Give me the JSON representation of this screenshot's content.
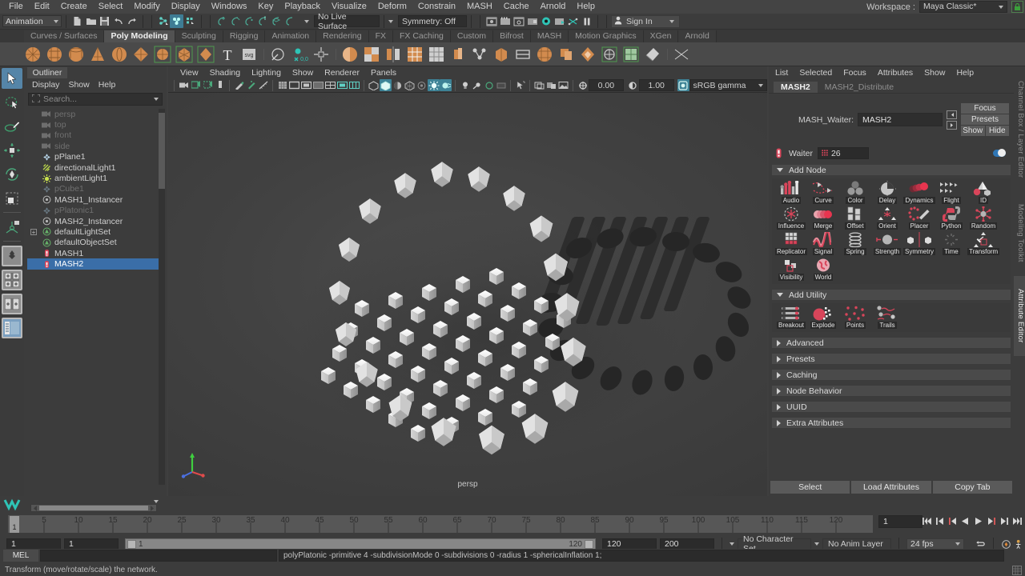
{
  "menubar": {
    "items": [
      "File",
      "Edit",
      "Create",
      "Select",
      "Modify",
      "Display",
      "Windows",
      "Key",
      "Playback",
      "Visualize",
      "Deform",
      "Constrain",
      "MASH",
      "Cache",
      "Arnold",
      "Help"
    ],
    "workspace_label": "Workspace :",
    "workspace_value": "Maya Classic*",
    "lock_icon": "lock-icon"
  },
  "statusline": {
    "mode": "Animation",
    "live_surface": "No Live Surface",
    "symmetry": "Symmetry: Off",
    "signin": "Sign In",
    "icons": [
      "new-scene-icon",
      "open-scene-icon",
      "save-scene-icon",
      "undo-icon",
      "redo-icon",
      "select-hierarchy-icon",
      "select-object-icon",
      "select-component-icon",
      "snap-grid-icon",
      "snap-curve-icon",
      "snap-point-icon",
      "snap-projected-icon",
      "snap-view-plane-icon",
      "make-live-icon",
      "render-current-frame-icon",
      "ipr-render-icon",
      "render-settings-icon",
      "hypershade-icon",
      "render-view-icon",
      "render-sequence-icon",
      "editor-icon",
      "pause-icon",
      "user-icon"
    ]
  },
  "shelf": {
    "tabs": [
      "Curves / Surfaces",
      "Poly Modeling",
      "Sculpting",
      "Rigging",
      "Animation",
      "Rendering",
      "FX",
      "FX Caching",
      "Custom",
      "Bifrost",
      "MASH",
      "Motion Graphics",
      "XGen",
      "Arnold"
    ],
    "active_tab": "Poly Modeling",
    "icons": [
      "poly-sphere-icon",
      "poly-cube-icon",
      "poly-cylinder-icon",
      "poly-cone-icon",
      "poly-torus-icon",
      "poly-plane-icon",
      "poly-disc-icon",
      "poly-platonic-icon",
      "poly-prism-icon",
      "poly-type-icon",
      "poly-svg-icon",
      "poly-sculpt-icon",
      "poly-target-weld-icon",
      "poly-move-icon",
      "combine-icon",
      "boolean-icon",
      "mirror-icon",
      "multi-cut-icon",
      "quad-draw-icon",
      "extrude-icon",
      "bevel-icon",
      "bridge-icon",
      "append-icon",
      "wedge-icon",
      "duplicate-face-icon",
      "circularize-icon",
      "smooth-icon",
      "reduce-icon",
      "triangulate-icon",
      "quadrangulate-icon",
      "crease-icon",
      "uv-editor-icon",
      "normals-icon"
    ]
  },
  "toolbox": {
    "tools": [
      "select-tool",
      "lasso-select-tool",
      "paint-select-tool",
      "move-tool",
      "rotate-tool",
      "scale-tool",
      "last-tool",
      "soft-select-tool",
      "single-pane-layout",
      "four-pane-layout",
      "two-pane-layout",
      "outliner-persp-layout"
    ],
    "active": "select-tool"
  },
  "outliner": {
    "title": "Outliner",
    "menus": [
      "Display",
      "Show",
      "Help"
    ],
    "search_placeholder": "Search...",
    "items": [
      {
        "label": "persp",
        "icon": "camera-icon",
        "state": "dim"
      },
      {
        "label": "top",
        "icon": "camera-icon",
        "state": "dim"
      },
      {
        "label": "front",
        "icon": "camera-icon",
        "state": "dim"
      },
      {
        "label": "side",
        "icon": "camera-icon",
        "state": "dim"
      },
      {
        "label": "pPlane1",
        "icon": "transform-icon",
        "state": "normal"
      },
      {
        "label": "directionalLight1",
        "icon": "directional-light-icon",
        "state": "normal"
      },
      {
        "label": "ambientLight1",
        "icon": "ambient-light-icon",
        "state": "normal"
      },
      {
        "label": "pCube1",
        "icon": "transform-icon",
        "state": "dim"
      },
      {
        "label": "MASH1_Instancer",
        "icon": "instancer-icon",
        "state": "normal"
      },
      {
        "label": "pPlatonic1",
        "icon": "transform-icon",
        "state": "dim"
      },
      {
        "label": "MASH2_Instancer",
        "icon": "instancer-icon",
        "state": "normal"
      },
      {
        "label": "defaultLightSet",
        "icon": "set-icon",
        "state": "normal",
        "expandable": true
      },
      {
        "label": "defaultObjectSet",
        "icon": "set-icon",
        "state": "normal"
      },
      {
        "label": "MASH1",
        "icon": "mash-icon",
        "state": "normal"
      },
      {
        "label": "MASH2",
        "icon": "mash-icon",
        "state": "selected"
      }
    ]
  },
  "viewport": {
    "menus": [
      "View",
      "Shading",
      "Lighting",
      "Show",
      "Renderer",
      "Panels"
    ],
    "camera_label": "persp",
    "gamma_value_1": "0.00",
    "gamma_value_2": "1.00",
    "color_space": "sRGB gamma",
    "toolbar_icons": [
      "camera-attributes-icon",
      "two-pane-icon",
      "bookmark-icon",
      "image-plane-icon",
      "paint-effects-icon",
      "grease-pencil-icon",
      "measure-icon",
      "grid-icon",
      "film-gate-icon",
      "resolution-gate-icon",
      "gate-mask-icon",
      "xray-icon",
      "xray-joints-icon",
      "wireframe-icon",
      "smooth-shade-icon",
      "hardware-texture-icon",
      "use-all-lights-icon",
      "shadows-icon",
      "screen-space-ao-icon",
      "motion-blur-icon",
      "multisample-icon",
      "isolate-select-icon",
      "lights-icon",
      "no-lights-icon",
      "default-lights-icon",
      "all-lights-icon",
      "select-mask-icon",
      "display-layer-icon",
      "panel-layout-icon",
      "exposure-icon"
    ]
  },
  "attribute_editor": {
    "menus": [
      "List",
      "Selected",
      "Focus",
      "Attributes",
      "Show",
      "Help"
    ],
    "tabs": [
      {
        "label": "MASH2",
        "active": true
      },
      {
        "label": "MASH2_Distribute",
        "active": false
      }
    ],
    "node_label": "MASH_Waiter:",
    "node_value": "MASH2",
    "buttons": {
      "focus": "Focus",
      "presets": "Presets",
      "show": "Show",
      "hide": "Hide"
    },
    "waiter": {
      "label": "Waiter",
      "value": "26",
      "icon": "mash-waiter-icon"
    },
    "sections": {
      "add_node": "Add Node",
      "add_utility": "Add Utility",
      "collapsed": [
        "Advanced",
        "Presets",
        "Caching",
        "Node Behavior",
        "UUID",
        "Extra Attributes"
      ]
    },
    "nodes": [
      {
        "label": "Audio",
        "icon": "audio-node-icon"
      },
      {
        "label": "Curve",
        "icon": "curve-node-icon"
      },
      {
        "label": "Color",
        "icon": "color-node-icon"
      },
      {
        "label": "Delay",
        "icon": "delay-node-icon"
      },
      {
        "label": "Dynamics",
        "icon": "dynamics-node-icon"
      },
      {
        "label": "Flight",
        "icon": "flight-node-icon"
      },
      {
        "label": "ID",
        "icon": "id-node-icon"
      },
      {
        "label": "Influence",
        "icon": "influence-node-icon"
      },
      {
        "label": "Merge",
        "icon": "merge-node-icon"
      },
      {
        "label": "Offset",
        "icon": "offset-node-icon"
      },
      {
        "label": "Orient",
        "icon": "orient-node-icon"
      },
      {
        "label": "Placer",
        "icon": "placer-node-icon"
      },
      {
        "label": "Python",
        "icon": "python-node-icon"
      },
      {
        "label": "Random",
        "icon": "random-node-icon"
      },
      {
        "label": "Replicator",
        "icon": "replicator-node-icon"
      },
      {
        "label": "Signal",
        "icon": "signal-node-icon"
      },
      {
        "label": "Spring",
        "icon": "spring-node-icon"
      },
      {
        "label": "Strength",
        "icon": "strength-node-icon"
      },
      {
        "label": "Symmetry",
        "icon": "symmetry-node-icon"
      },
      {
        "label": "Time",
        "icon": "time-node-icon"
      },
      {
        "label": "Transform",
        "icon": "transform-node-icon"
      },
      {
        "label": "Visibility",
        "icon": "visibility-node-icon"
      },
      {
        "label": "World",
        "icon": "world-node-icon"
      }
    ],
    "utilities": [
      {
        "label": "Breakout",
        "icon": "breakout-utility-icon"
      },
      {
        "label": "Explode",
        "icon": "explode-utility-icon"
      },
      {
        "label": "Points",
        "icon": "points-utility-icon"
      },
      {
        "label": "Trails",
        "icon": "trails-utility-icon"
      }
    ],
    "bottom_buttons": [
      "Select",
      "Load Attributes",
      "Copy Tab"
    ],
    "vertical_tabs": [
      {
        "label": "Channel Box / Layer Editor",
        "active": false
      },
      {
        "label": "Modeling Toolkit",
        "active": false
      },
      {
        "label": "Attribute Editor",
        "active": true
      }
    ]
  },
  "timeline": {
    "ticks": [
      5,
      10,
      15,
      20,
      25,
      30,
      35,
      40,
      45,
      50,
      55,
      60,
      65,
      70,
      75,
      80,
      85,
      90,
      95,
      100,
      105,
      110,
      115,
      120
    ],
    "current_frame_marker": "1",
    "current_frame_field": "1",
    "playback_icons": [
      "go-to-start-icon",
      "step-back-key-icon",
      "step-back-frame-icon",
      "play-backwards-icon",
      "play-forwards-icon",
      "step-forward-frame-icon",
      "step-forward-key-icon",
      "go-to-end-icon"
    ]
  },
  "range": {
    "start_field": "1",
    "end_field": "1",
    "slider_start": "1",
    "slider_end": "120",
    "anim_start": "120",
    "anim_end": "200",
    "character_set": "No Character Set",
    "anim_layer": "No Anim Layer",
    "fps": "24 fps",
    "icons": [
      "auto-key-icon",
      "animation-preferences-icon",
      "loop-icon"
    ]
  },
  "command_line": {
    "language": "MEL",
    "input_value": "",
    "output_value": "polyPlatonic -primitive 4 -subdivisionMode 0 -subdivisions 0 -radius 1 -sphericalInflation 1;"
  },
  "help_line": {
    "text": "Transform (move/rotate/scale) the network.",
    "slider_icon": "help-slider-icon"
  },
  "colors": {
    "accent_blue": "#3a6ea8",
    "teal": "#3d8296",
    "shelf_orange": "#d28b4e",
    "mash_red": "#d93a4a",
    "panel_bg": "#3c3c3c",
    "viewport_bg": "#444444"
  }
}
